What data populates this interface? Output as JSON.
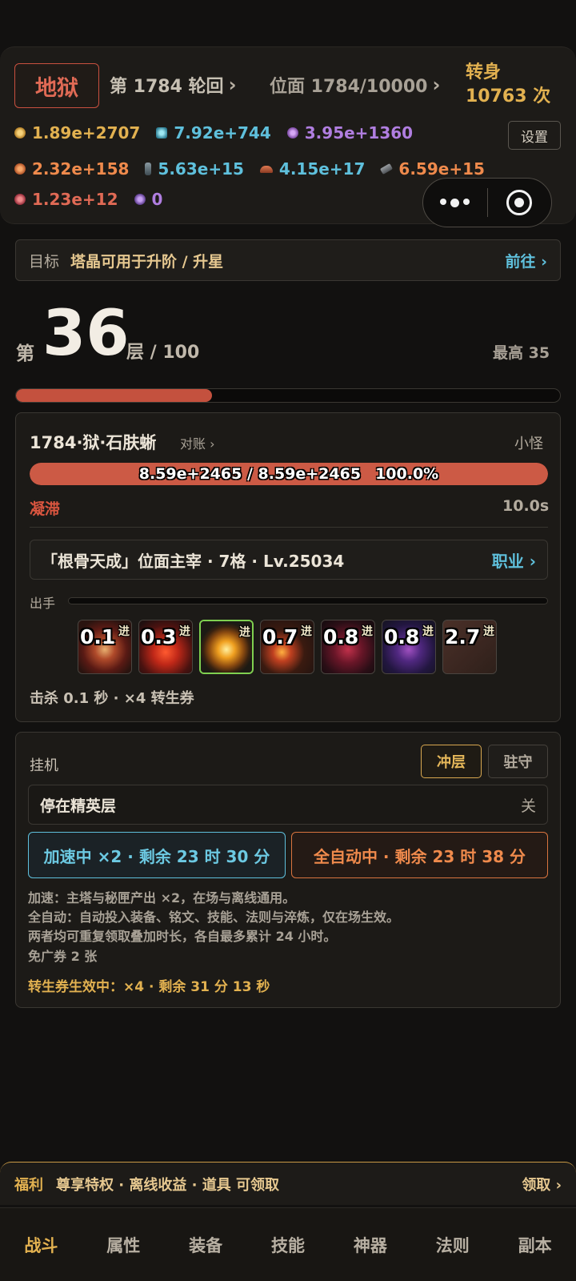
{
  "header": {
    "realm": "地狱",
    "cycle_label": "第 1784 轮回",
    "plane_label": "位面 1784/10000",
    "rebirth_label": "转身",
    "rebirth_count": "10763 次",
    "settings_label": "设置"
  },
  "resources": {
    "row1": [
      {
        "icon": "gold-coin-icon",
        "color": "#e2b150",
        "value": "1.89e+2707"
      },
      {
        "icon": "blue-gem-icon",
        "color": "#5fc0dc",
        "value": "7.92e+744"
      },
      {
        "icon": "purple-orb-icon",
        "color": "#b07ee0",
        "value": "3.95e+1360"
      }
    ],
    "row2": [
      {
        "icon": "fire-pouch-icon",
        "color": "#ef8a4c",
        "value": "2.32e+158"
      },
      {
        "icon": "crystal-shard-icon",
        "color": "#5fc0dc",
        "value": "5.63e+15"
      },
      {
        "icon": "ore-pile-icon",
        "color": "#5fc0dc",
        "value": "4.15e+17"
      },
      {
        "icon": "scroll-icon",
        "color": "#ef8a4c",
        "value": "6.59e+15"
      }
    ],
    "row3": [
      {
        "icon": "red-rune-icon",
        "color": "#e06a55",
        "value": "1.23e+12"
      },
      {
        "icon": "violet-rune-icon",
        "color": "#b07ee0",
        "value": "0"
      }
    ]
  },
  "goal": {
    "label": "目标",
    "text": "塔晶可用于升阶 / 升星",
    "action": "前往 ›"
  },
  "floor": {
    "prefix": "第",
    "number": "36",
    "suffix": "层 / 100",
    "max_label": "最高 35",
    "progress": 0.36
  },
  "enemy": {
    "name": "1784·狱·石肤蜥",
    "reconcile": "对账 ›",
    "type": "小怪",
    "hp_text": "8.59e+2465 / 8.59e+2465",
    "hp_percent": "100.0%",
    "hp_ratio": 1.0,
    "status": "凝滞",
    "status_time": "10.0s"
  },
  "class_bar": {
    "text": "「根骨天成」位面主宰 · 7格 · Lv.25034",
    "action": "职业 ›"
  },
  "attack": {
    "label": "出手",
    "skills": [
      {
        "cd": "0.1",
        "adv": "进",
        "icon": "spiked-ring-icon"
      },
      {
        "cd": "0.3",
        "adv": "进",
        "icon": "lava-burst-icon"
      },
      {
        "cd": "",
        "adv": "进",
        "icon": "golden-flame-icon"
      },
      {
        "cd": "0.7",
        "adv": "进",
        "icon": "fire-wheel-icon"
      },
      {
        "cd": "0.8",
        "adv": "进",
        "icon": "blood-rune-icon"
      },
      {
        "cd": "0.8",
        "adv": "进",
        "icon": "void-orb-icon"
      },
      {
        "cd": "2.7",
        "adv": "进",
        "icon": "stone-glyph-icon"
      }
    ],
    "kill_info": "击杀 0.1 秒 · ×4 转生券"
  },
  "idle": {
    "title": "挂机",
    "mode_climb": "冲层",
    "mode_guard": "驻守",
    "elite_label": "停在精英层",
    "elite_value": "关",
    "boost_label": "加速中 ×2 · 剩余 23 时 30 分",
    "auto_label": "全自动中 · 剩余 23 时 38 分",
    "notes": [
      "加速：主塔与秘匣产出 ×2，在场与离线通用。",
      "全自动：自动投入装备、铭文、技能、法则与淬炼，仅在场生效。",
      "两者均可重复领取叠加时长，各自最多累计 24 小时。",
      "免广券 2 张"
    ],
    "ticket_note": "转生券生效中：×4 · 剩余 31 分 13 秒"
  },
  "welfare": {
    "label": "福利",
    "text": "尊享特权 · 离线收益 · 道具 可领取",
    "action": "领取 ›"
  },
  "nav": {
    "tabs": [
      "战斗",
      "属性",
      "装备",
      "技能",
      "神器",
      "法则",
      "副本"
    ],
    "active_index": 0
  }
}
